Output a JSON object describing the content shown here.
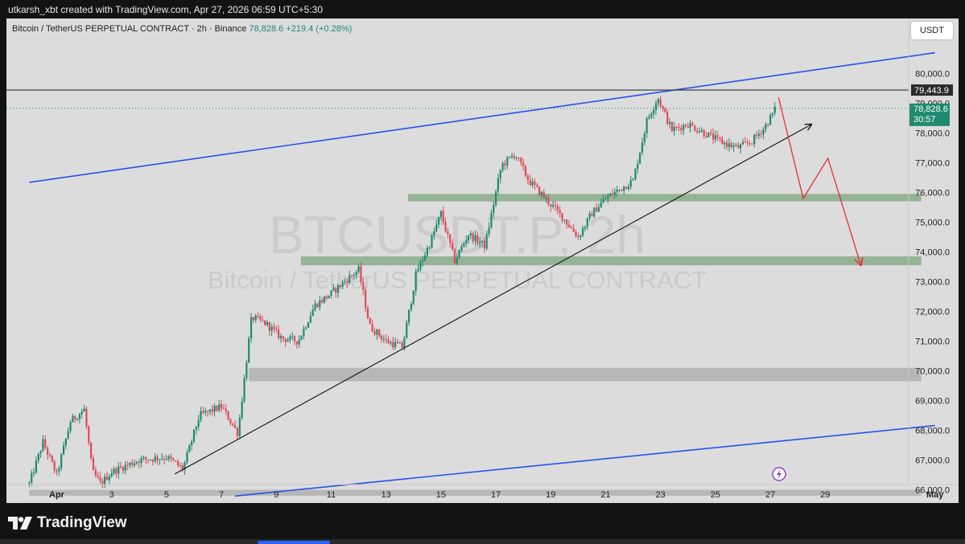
{
  "credit": "utkarsh_xbt created with TradingView.com, Apr 27, 2026 06:59 UTC+5:30",
  "header": {
    "symbol": "Bitcoin / TetherUS PERPETUAL CONTRACT · 2h · Binance",
    "last": "78,828.6",
    "change": "+219.4 (+0.28%)"
  },
  "currency": "USDT",
  "watermark": {
    "ticker": "BTCUSDT.P, 2h",
    "name": "Bitcoin / TetherUS PERPETUAL CONTRACT"
  },
  "footer": {
    "logo_text": "TradingView"
  },
  "icons": {
    "logo": "tradingview-logo-icon",
    "replay": "lightning-icon"
  },
  "colors": {
    "up": "#1f8a70",
    "down": "#e04a55",
    "channel": "#2752e6",
    "zone_green": "#8aac8a",
    "zone_gray": "#b2b2b2",
    "price_tag": "#1f8a70",
    "arrow": "#e0303a"
  },
  "chart_data": {
    "type": "candlestick",
    "title": "Bitcoin / TetherUS PERPETUAL CONTRACT · 2h · Binance",
    "x_ticks": [
      "Apr",
      "3",
      "5",
      "7",
      "9",
      "11",
      "13",
      "15",
      "17",
      "19",
      "21",
      "23",
      "25",
      "27",
      "29",
      "May"
    ],
    "y_ticks": [
      "66,000.0",
      "67,000.0",
      "68,000.0",
      "69,000.0",
      "70,000.0",
      "71,000.0",
      "72,000.0",
      "73,000.0",
      "74,000.0",
      "75,000.0",
      "76,000.0",
      "77,000.0",
      "78,000.0",
      "79,000.0",
      "80,000.0"
    ],
    "ylim": [
      65800,
      81400
    ],
    "xlim": [
      "Mar 30",
      "May 2"
    ],
    "price_path": [
      {
        "d": 0.0,
        "p": 66200
      },
      {
        "d": 0.5,
        "p": 67600
      },
      {
        "d": 1.0,
        "p": 66500
      },
      {
        "d": 1.5,
        "p": 68300
      },
      {
        "d": 2.0,
        "p": 68700
      },
      {
        "d": 2.3,
        "p": 66600
      },
      {
        "d": 2.6,
        "p": 66200
      },
      {
        "d": 3.0,
        "p": 66600
      },
      {
        "d": 4.0,
        "p": 67000
      },
      {
        "d": 5.0,
        "p": 67100
      },
      {
        "d": 5.6,
        "p": 66700
      },
      {
        "d": 6.2,
        "p": 68500
      },
      {
        "d": 7.0,
        "p": 68800
      },
      {
        "d": 7.6,
        "p": 67900
      },
      {
        "d": 8.1,
        "p": 71800
      },
      {
        "d": 8.6,
        "p": 71600
      },
      {
        "d": 9.2,
        "p": 71100
      },
      {
        "d": 9.8,
        "p": 71000
      },
      {
        "d": 10.4,
        "p": 72200
      },
      {
        "d": 11.0,
        "p": 72600
      },
      {
        "d": 11.6,
        "p": 73100
      },
      {
        "d": 12.0,
        "p": 73400
      },
      {
        "d": 12.4,
        "p": 71500
      },
      {
        "d": 13.0,
        "p": 71000
      },
      {
        "d": 13.6,
        "p": 70800
      },
      {
        "d": 14.1,
        "p": 73300
      },
      {
        "d": 14.6,
        "p": 74300
      },
      {
        "d": 15.0,
        "p": 75300
      },
      {
        "d": 15.5,
        "p": 73700
      },
      {
        "d": 16.0,
        "p": 74600
      },
      {
        "d": 16.6,
        "p": 74200
      },
      {
        "d": 17.2,
        "p": 76900
      },
      {
        "d": 17.7,
        "p": 77300
      },
      {
        "d": 18.2,
        "p": 76400
      },
      {
        "d": 18.8,
        "p": 75800
      },
      {
        "d": 19.4,
        "p": 75200
      },
      {
        "d": 20.0,
        "p": 74500
      },
      {
        "d": 20.5,
        "p": 75300
      },
      {
        "d": 21.0,
        "p": 75800
      },
      {
        "d": 21.5,
        "p": 76100
      },
      {
        "d": 22.0,
        "p": 76400
      },
      {
        "d": 22.5,
        "p": 78400
      },
      {
        "d": 22.9,
        "p": 79200
      },
      {
        "d": 23.4,
        "p": 78100
      },
      {
        "d": 24.0,
        "p": 78300
      },
      {
        "d": 24.6,
        "p": 78000
      },
      {
        "d": 25.2,
        "p": 77700
      },
      {
        "d": 25.8,
        "p": 77500
      },
      {
        "d": 26.3,
        "p": 77700
      },
      {
        "d": 26.8,
        "p": 78200
      },
      {
        "d": 27.2,
        "p": 78830
      }
    ],
    "horizontal_lines": [
      {
        "price": 79443.9,
        "label": "79,443.9"
      }
    ],
    "last_price": {
      "price": 78828.6,
      "label": "78,828.6",
      "countdown": "30:57"
    },
    "zones": [
      {
        "from_day": 13.8,
        "to_day": 32.5,
        "low": 75700,
        "high": 75950,
        "color": "green"
      },
      {
        "from_day": 9.9,
        "to_day": 32.5,
        "low": 73550,
        "high": 73850,
        "color": "green"
      },
      {
        "from_day": 8.0,
        "to_day": 32.5,
        "low": 69650,
        "high": 70100,
        "color": "gray"
      },
      {
        "from_day": 0.0,
        "to_day": 32.5,
        "low": 65800,
        "high": 66000,
        "color": "gray"
      }
    ],
    "channel": {
      "upper": [
        {
          "day": 0.0,
          "price": 76340
        },
        {
          "day": 33.0,
          "price": 80700
        }
      ],
      "lower": [
        {
          "day": 7.5,
          "price": 65790
        },
        {
          "day": 33.0,
          "price": 68160
        }
      ]
    },
    "trendline": [
      {
        "day": 5.3,
        "price": 66530
      },
      {
        "day": 28.5,
        "price": 78290
      }
    ],
    "projection": [
      {
        "day": 27.3,
        "price": 79200
      },
      {
        "day": 28.2,
        "price": 75800
      },
      {
        "day": 29.1,
        "price": 77150
      },
      {
        "day": 30.3,
        "price": 73550
      }
    ]
  }
}
